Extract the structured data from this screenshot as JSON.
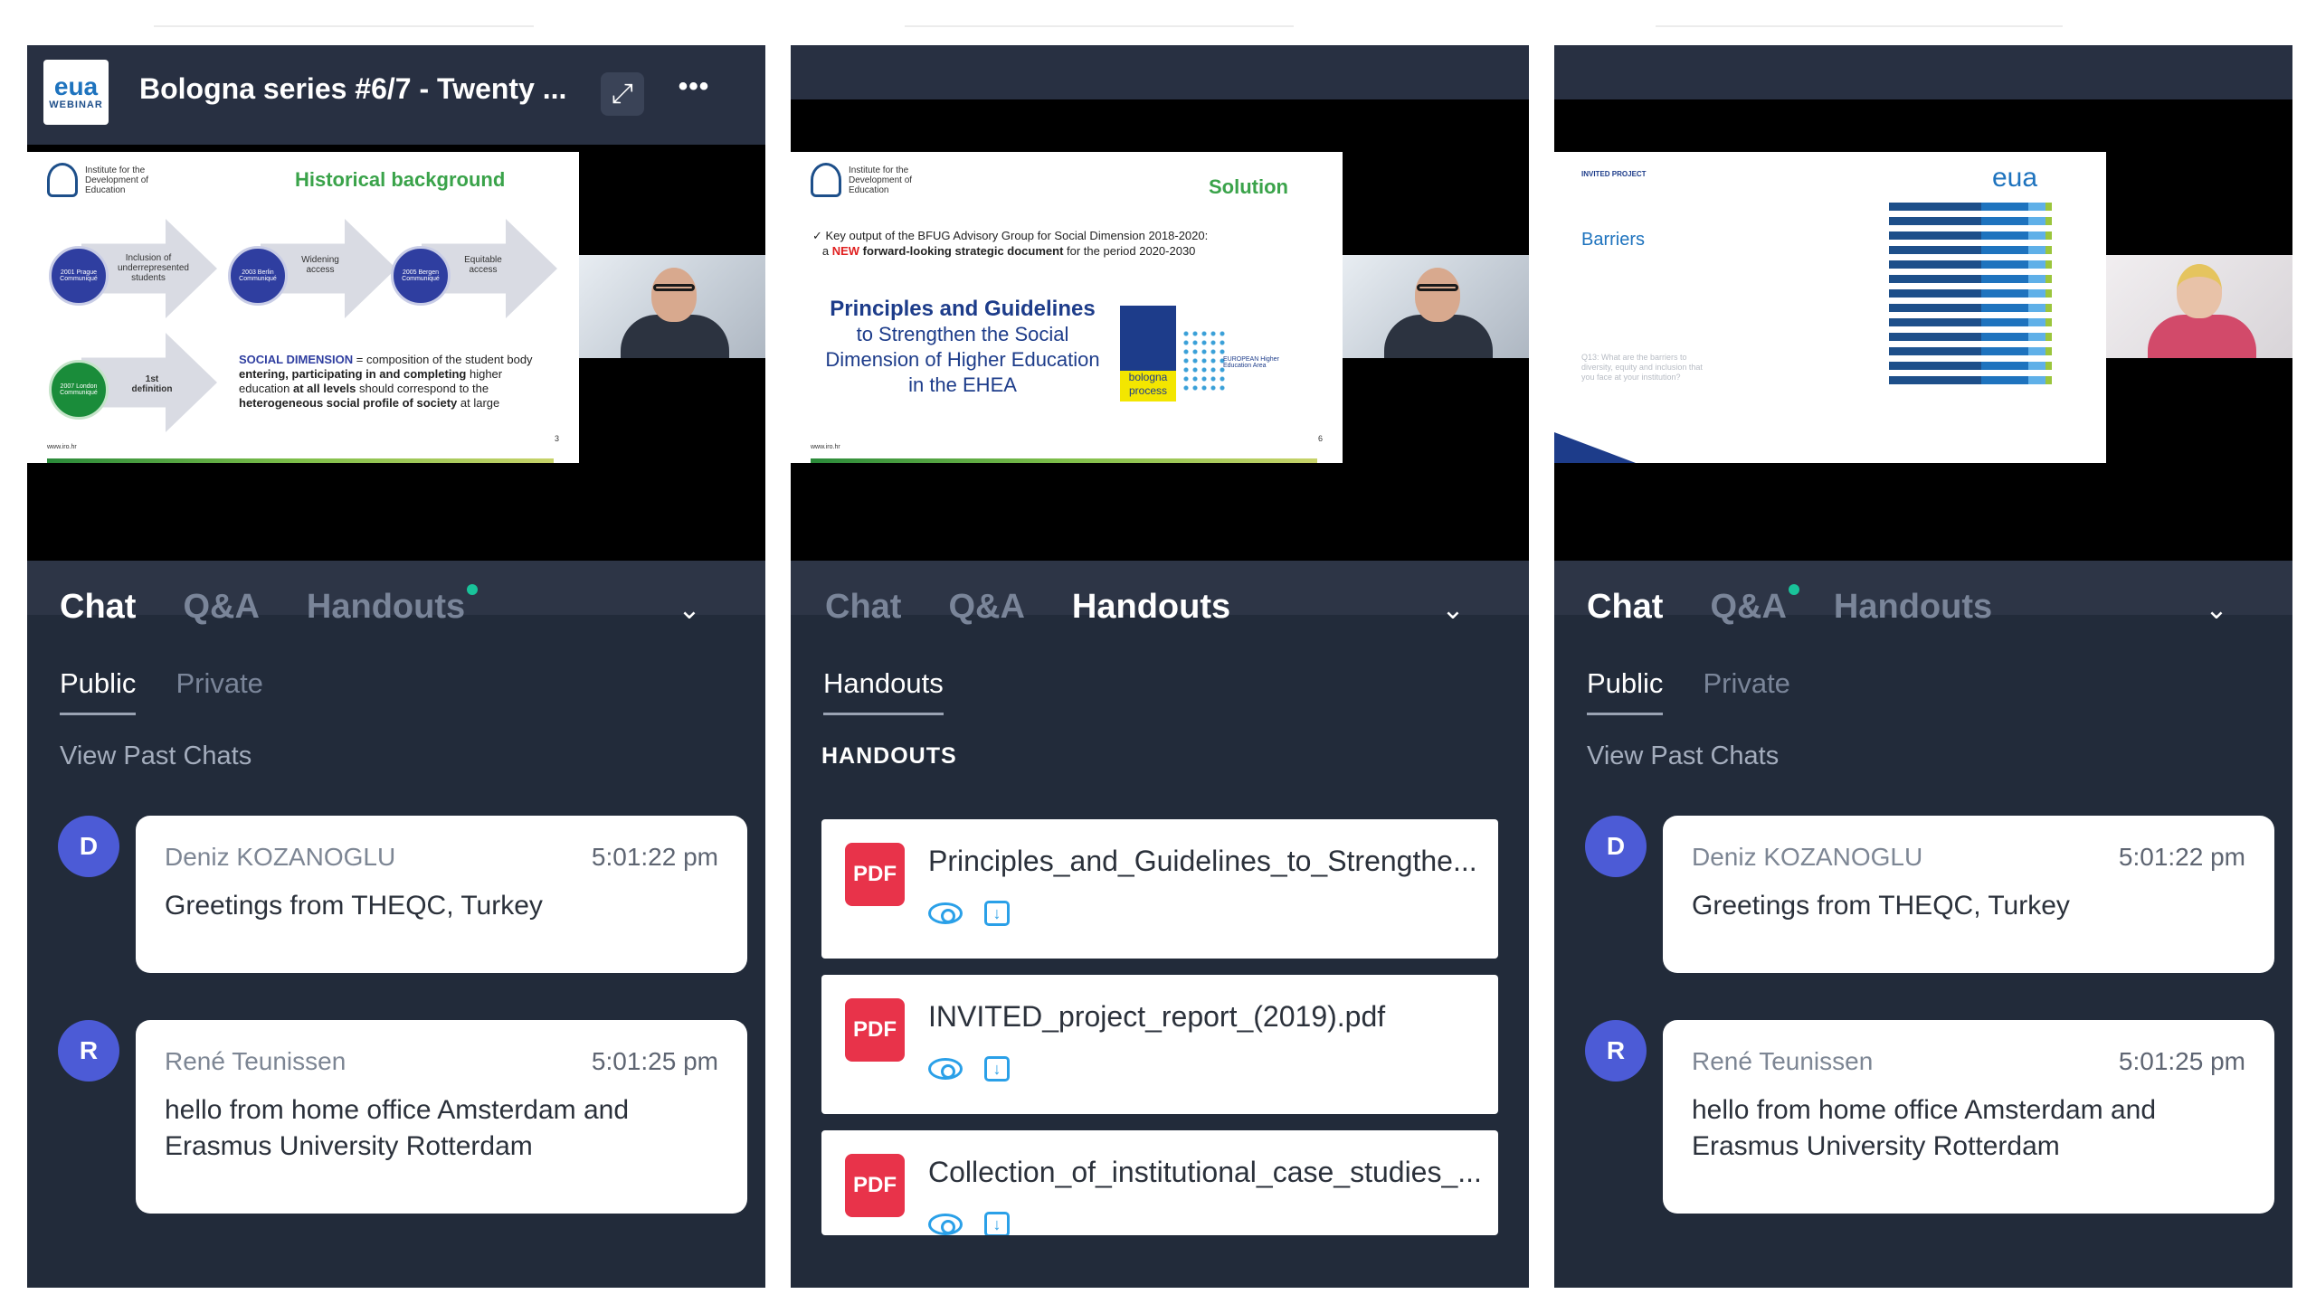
{
  "panels": [
    {
      "logo": {
        "main": "eua",
        "sub": "WEBINAR"
      },
      "title": "Bologna series #6/7 - Twenty ...",
      "slide": {
        "institute": "Institute for the Development of Education",
        "heading": "Historical background",
        "arrows": [
          {
            "circle": "2001 Prague Communiqué",
            "label": "Inclusion of underrepresented students"
          },
          {
            "circle": "2003 Berlin Communiqué",
            "label": "Widening access"
          },
          {
            "circle": "2005 Bergen Communiqué",
            "label": "Equitable access"
          },
          {
            "circle": "2007 London Communiqué",
            "label": "1st definition"
          }
        ],
        "sd_lead": "SOCIAL DIMENSION",
        "sd_p1": " = composition of the student body ",
        "sd_b1": "entering, participating in and completing",
        "sd_p2": " higher education ",
        "sd_b2": "at all levels",
        "sd_p3": " should correspond to the ",
        "sd_b3": "heterogeneous social profile of society",
        "sd_p4": " at large",
        "page": "3",
        "url": "www.iro.hr"
      },
      "tabs": [
        {
          "label": "Chat"
        },
        {
          "label": "Q&A"
        },
        {
          "label": "Handouts"
        }
      ],
      "subtabs": [
        {
          "label": "Public"
        },
        {
          "label": "Private"
        }
      ],
      "past": "View Past Chats",
      "messages": [
        {
          "avatar": "D",
          "name": "Deniz KOZANOGLU",
          "time": "5:01:22 pm",
          "text": "Greetings from THEQC, Turkey"
        },
        {
          "avatar": "R",
          "name": "René Teunissen",
          "time": "5:01:25 pm",
          "text": "hello from home office Amsterdam and Erasmus University Rotterdam"
        }
      ]
    },
    {
      "slide": {
        "institute": "Institute for the Development of Education",
        "heading": "Solution",
        "bullet_p1": "Key output of the BFUG Advisory Group for Social Dimension 2018-2020:",
        "bullet_new": "NEW",
        "bullet_p2": "forward-looking strategic document",
        "bullet_p3": " for the period 2020-2030",
        "pg_title": "Principles and Guidelines",
        "pg_sub": "to Strengthen the Social Dimension of Higher Education in the EHEA",
        "bologna": "bologna process",
        "ehea": "EUROPEAN Higher Education Area",
        "page": "6",
        "url": "www.iro.hr"
      },
      "tabs": [
        {
          "label": "Chat"
        },
        {
          "label": "Q&A"
        },
        {
          "label": "Handouts"
        }
      ],
      "subtab": "Handouts",
      "section": "HANDOUTS",
      "pdf_badge": "PDF",
      "files": [
        {
          "name": "Principles_and_Guidelines_to_Strengthe..."
        },
        {
          "name": "INVITED_project_report_(2019).pdf"
        },
        {
          "name": "Collection_of_institutional_case_studies_..."
        }
      ]
    },
    {
      "slide": {
        "project": "INVITED PROJECT",
        "heading": "Barriers",
        "question": "Q13: What are the barriers to diversity, equity and inclusion that you face at your institution?",
        "logo": "eua",
        "bars": [
          55,
          28,
          10,
          4
        ]
      },
      "tabs": [
        {
          "label": "Chat"
        },
        {
          "label": "Q&A"
        },
        {
          "label": "Handouts"
        }
      ],
      "subtabs": [
        {
          "label": "Public"
        },
        {
          "label": "Private"
        }
      ],
      "past": "View Past Chats",
      "messages": [
        {
          "avatar": "D",
          "name": "Deniz KOZANOGLU",
          "time": "5:01:22 pm",
          "text": "Greetings from THEQC, Turkey"
        },
        {
          "avatar": "R",
          "name": "René Teunissen",
          "time": "5:01:25 pm",
          "text": "hello from home office Amsterdam and Erasmus University Rotterdam"
        }
      ]
    }
  ],
  "colors": {
    "panel_bg": "#222b3a",
    "accent_dot": "#19c39a",
    "avatar": "#4c5bd6",
    "pdf": "#e8334a",
    "icon": "#2aa0e8"
  }
}
